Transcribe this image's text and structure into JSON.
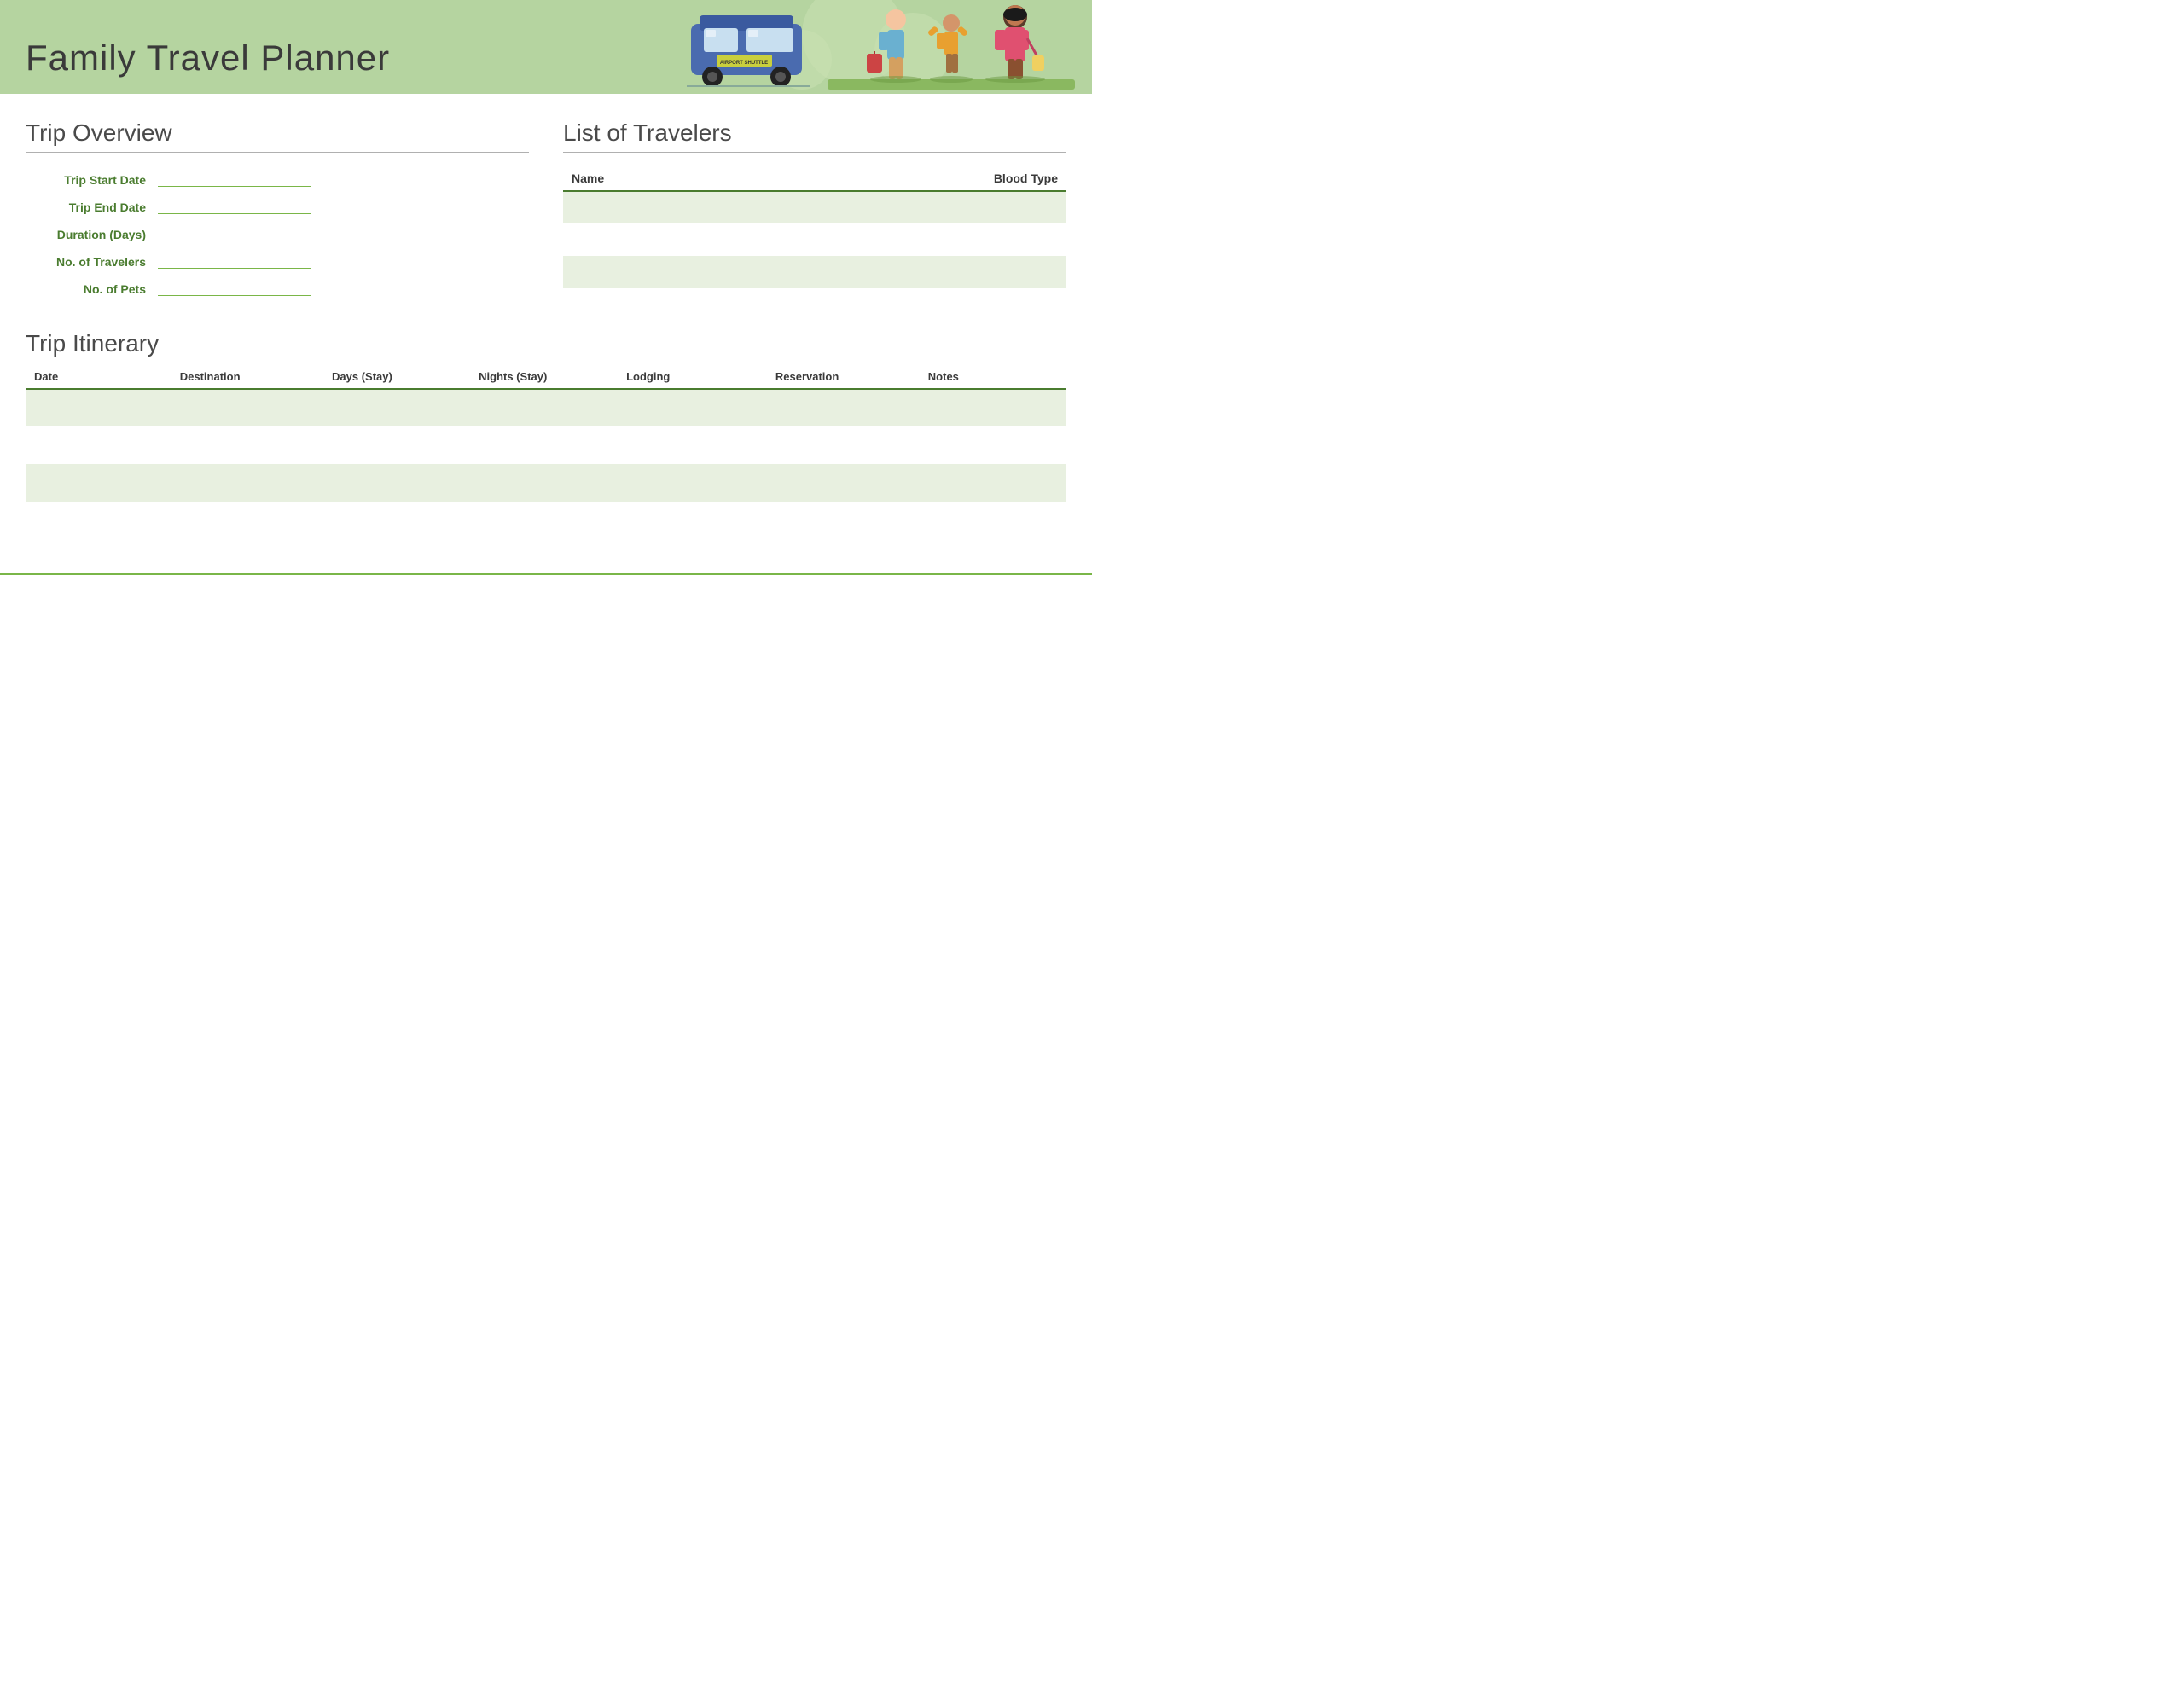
{
  "header": {
    "title": "Family Travel Planner",
    "bus_label": "AIRPORT SHUTTLE"
  },
  "trip_overview": {
    "section_title": "Trip Overview",
    "fields": [
      {
        "label": "Trip Start Date",
        "value": ""
      },
      {
        "label": "Trip End Date",
        "value": ""
      },
      {
        "label": "Duration (Days)",
        "value": ""
      },
      {
        "label": "No. of Travelers",
        "value": ""
      },
      {
        "label": "No. of Pets",
        "value": ""
      }
    ]
  },
  "travelers": {
    "section_title": "List of Travelers",
    "columns": [
      "Name",
      "Blood Type"
    ],
    "rows": [
      {
        "name": "",
        "blood_type": ""
      },
      {
        "name": "",
        "blood_type": ""
      },
      {
        "name": "",
        "blood_type": ""
      }
    ]
  },
  "itinerary": {
    "section_title": "Trip Itinerary",
    "columns": [
      "Date",
      "Destination",
      "Days (Stay)",
      "Nights (Stay)",
      "Lodging",
      "Reservation",
      "Notes"
    ],
    "rows": [
      {
        "date": "",
        "destination": "",
        "days": "",
        "nights": "",
        "lodging": "",
        "reservation": "",
        "notes": ""
      },
      {
        "date": "",
        "destination": "",
        "days": "",
        "nights": "",
        "lodging": "",
        "reservation": "",
        "notes": ""
      },
      {
        "date": "",
        "destination": "",
        "days": "",
        "nights": "",
        "lodging": "",
        "reservation": "",
        "notes": ""
      },
      {
        "date": "",
        "destination": "",
        "days": "",
        "nights": "",
        "lodging": "",
        "reservation": "",
        "notes": ""
      }
    ]
  }
}
